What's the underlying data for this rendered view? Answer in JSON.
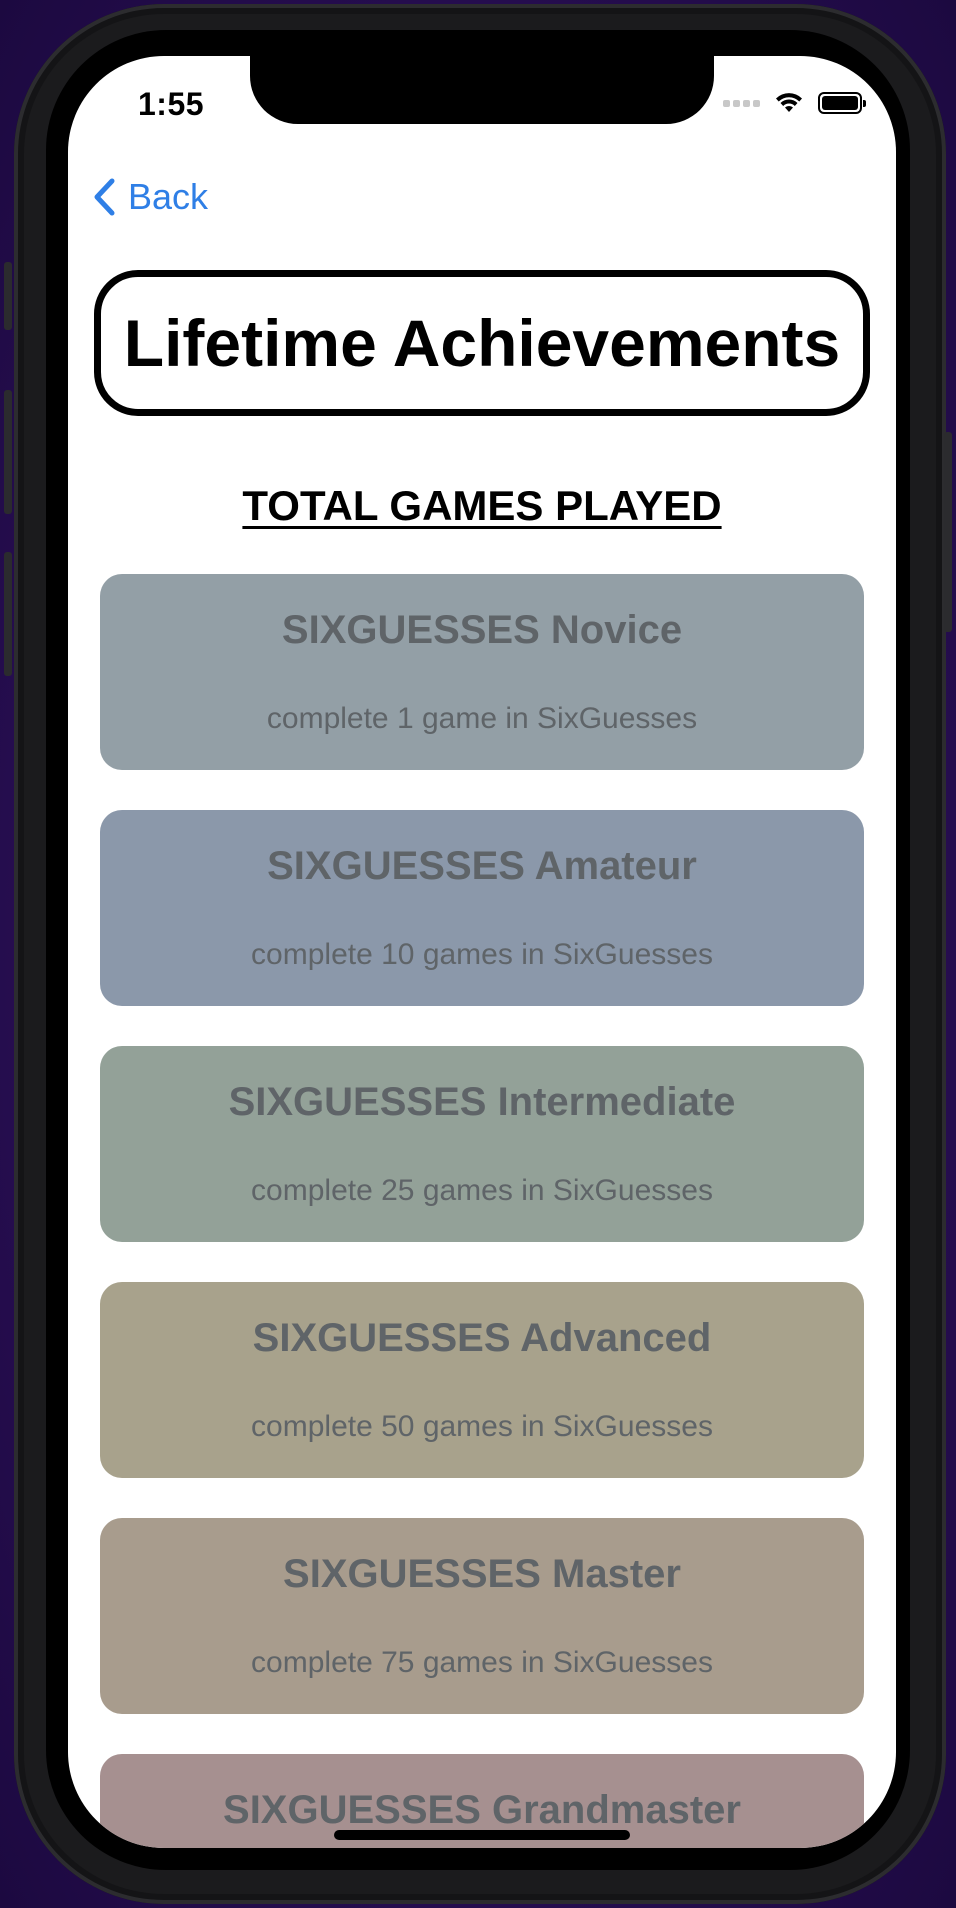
{
  "status_bar": {
    "time": "1:55"
  },
  "nav": {
    "back_label": "Back"
  },
  "page": {
    "title": "Lifetime Achievements",
    "section_heading": "TOTAL GAMES PLAYED"
  },
  "achievements": [
    {
      "title": "SIXGUESSES Novice",
      "description": "complete 1 game in SixGuesses",
      "color": "#939fa6"
    },
    {
      "title": "SIXGUESSES Amateur",
      "description": "complete 10 games in SixGuesses",
      "color": "#8b98aa"
    },
    {
      "title": "SIXGUESSES Intermediate",
      "description": "complete 25 games in SixGuesses",
      "color": "#93a198"
    },
    {
      "title": "SIXGUESSES Advanced",
      "description": "complete 50 games in SixGuesses",
      "color": "#a8a28c"
    },
    {
      "title": "SIXGUESSES Master",
      "description": "complete 75 games in SixGuesses",
      "color": "#a89c8d"
    },
    {
      "title": "SIXGUESSES Grandmaster",
      "description": "",
      "color": "#a69090"
    }
  ],
  "colors": {
    "accent": "#2f7fe6",
    "card_text": "#5f6468"
  }
}
